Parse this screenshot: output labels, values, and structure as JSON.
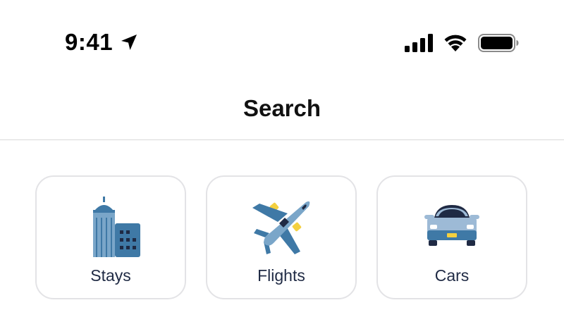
{
  "status_bar": {
    "time": "9:41",
    "icons": [
      "location-arrow-icon",
      "cellular-signal-icon",
      "wifi-icon",
      "battery-icon"
    ]
  },
  "header": {
    "title": "Search"
  },
  "categories": [
    {
      "label": "Stays",
      "icon": "hotel-building-icon"
    },
    {
      "label": "Flights",
      "icon": "airplane-icon"
    },
    {
      "label": "Cars",
      "icon": "car-icon"
    }
  ],
  "colors": {
    "background": "#ffffff",
    "text_primary": "#111111",
    "label_text": "#1f2a44",
    "card_border": "#e3e3e6",
    "icon_dark_navy": "#1f2a44",
    "icon_blue": "#7aa6c9",
    "icon_steel": "#3f79a6",
    "icon_light_blue": "#9dbad6",
    "icon_yellow": "#f4d03f"
  }
}
